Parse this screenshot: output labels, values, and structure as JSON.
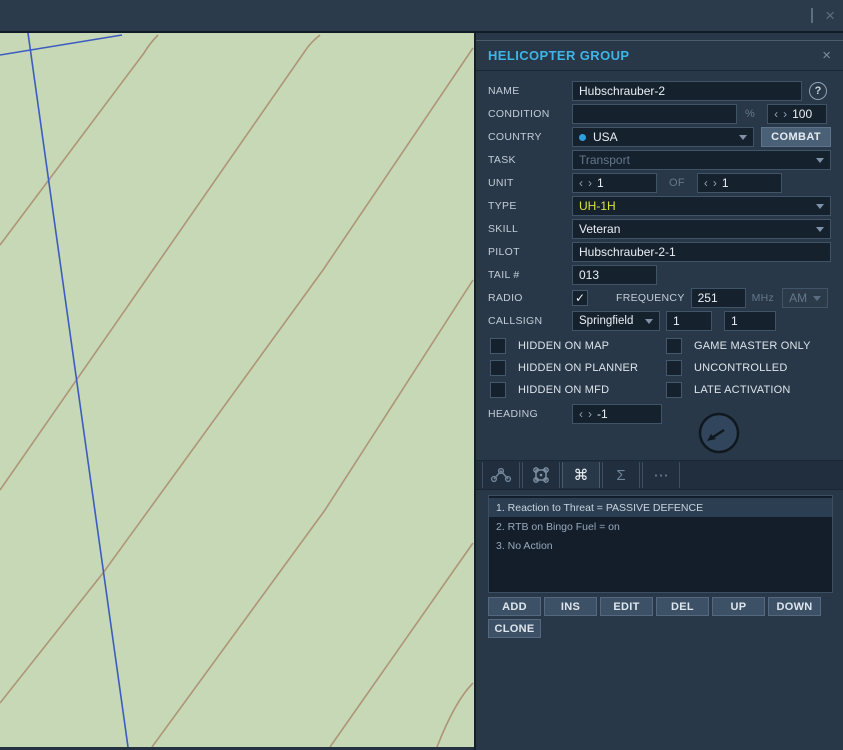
{
  "window": {
    "close_icon": "×"
  },
  "colors": {
    "map_bg": "#c6d8b5",
    "contour": "#ae9577",
    "road": "#3c5cc0",
    "accent_cyan": "#3fb4e6",
    "type_yellow": "#d9e43f"
  },
  "panel": {
    "title": "HELICOPTER GROUP",
    "close_icon": "×",
    "fields": {
      "name": {
        "label": "NAME",
        "value": "Hubschrauber-2",
        "help": "?"
      },
      "condition": {
        "label": "CONDITION",
        "value": "",
        "percent": "%",
        "spin_left": "‹",
        "spin_right": "›",
        "spin_value": "100"
      },
      "country": {
        "label": "COUNTRY",
        "value": "USA",
        "combat": "COMBAT"
      },
      "task": {
        "label": "TASK",
        "value": "Transport"
      },
      "unit": {
        "label": "UNIT",
        "count": "1",
        "of": "OF",
        "total": "1",
        "spin_left": "‹",
        "spin_right": "›"
      },
      "type": {
        "label": "TYPE",
        "value": "UH-1H"
      },
      "skill": {
        "label": "SKILL",
        "value": "Veteran"
      },
      "pilot": {
        "label": "PILOT",
        "value": "Hubschrauber-2-1"
      },
      "tail": {
        "label": "TAIL #",
        "value": "013"
      },
      "radio": {
        "label": "RADIO",
        "check_glyph": "✓",
        "freq_label": "FREQUENCY",
        "freq_value": "251",
        "unit": "MHz",
        "modulation": "AM"
      },
      "callsign": {
        "label": "CALLSIGN",
        "value": "Springfield",
        "num1": "1",
        "num2": "1"
      },
      "heading": {
        "label": "HEADING",
        "spin_left": "‹",
        "spin_right": "›",
        "value": "-1"
      }
    },
    "checkboxes": [
      {
        "label": "HIDDEN ON MAP"
      },
      {
        "label": "GAME MASTER ONLY"
      },
      {
        "label": "HIDDEN ON PLANNER"
      },
      {
        "label": "UNCONTROLLED"
      },
      {
        "label": "HIDDEN ON MFD"
      },
      {
        "label": "LATE ACTIVATION"
      }
    ],
    "tabs": [
      {
        "name": "route-icon",
        "glyph": ""
      },
      {
        "name": "zone-icon",
        "glyph": ""
      },
      {
        "name": "command-icon",
        "glyph": "⌘"
      },
      {
        "name": "sum-icon",
        "glyph": "Σ"
      },
      {
        "name": "more-icon",
        "glyph": "⋯"
      }
    ],
    "actions": {
      "items": [
        "1. Reaction to Threat = PASSIVE DEFENCE",
        "2. RTB on Bingo Fuel = on",
        "3. No Action"
      ],
      "selected_index": 0
    },
    "buttons": [
      "ADD",
      "INS",
      "EDIT",
      "DEL",
      "UP",
      "DOWN"
    ],
    "clone_button": "CLONE"
  }
}
